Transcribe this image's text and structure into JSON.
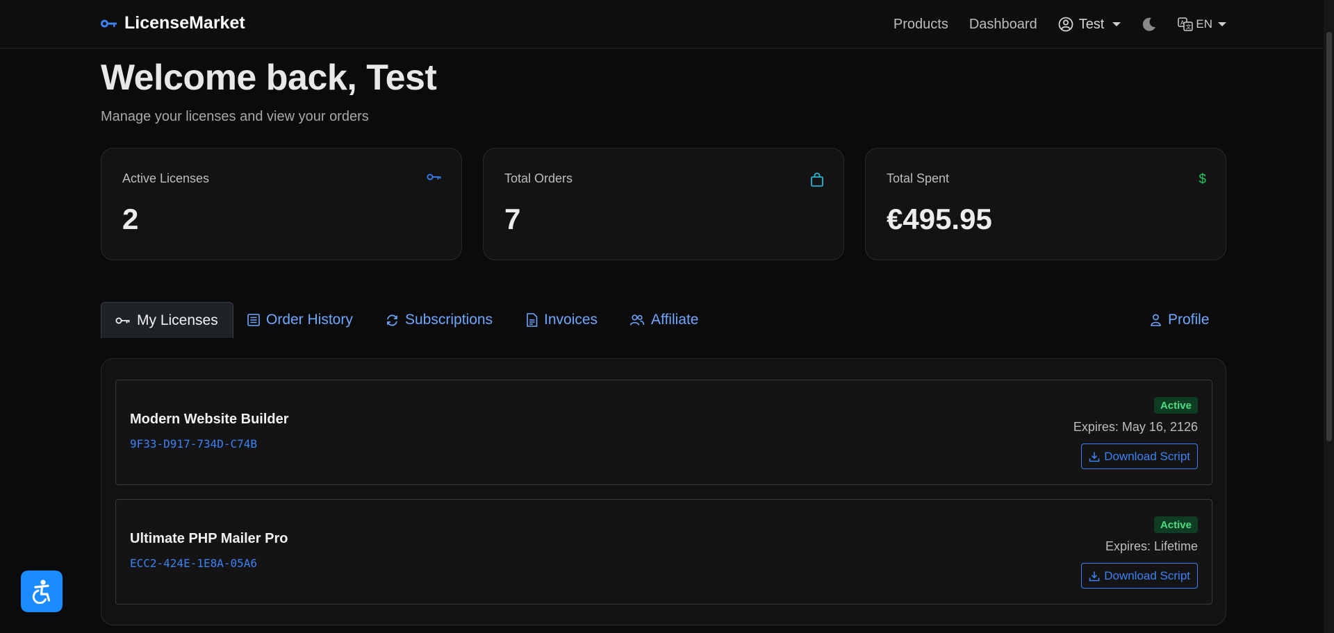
{
  "navbar": {
    "brand": "LicenseMarket",
    "products": "Products",
    "dashboard": "Dashboard",
    "user": "Test",
    "lang": "EN"
  },
  "header": {
    "title": "Welcome back, Test",
    "subtitle": "Manage your licenses and view your orders"
  },
  "stats": [
    {
      "label": "Active Licenses",
      "value": "2",
      "icon": "key-icon",
      "color": "#3b82f6"
    },
    {
      "label": "Total Orders",
      "value": "7",
      "icon": "bag-icon",
      "color": "#22b8cf"
    },
    {
      "label": "Total Spent",
      "value": "€495.95",
      "icon": "dollar-icon",
      "color": "#22c55e"
    }
  ],
  "tabs": {
    "my_licenses": "My Licenses",
    "order_history": "Order History",
    "subscriptions": "Subscriptions",
    "invoices": "Invoices",
    "affiliate": "Affiliate",
    "profile": "Profile"
  },
  "licenses": [
    {
      "name": "Modern Website Builder",
      "key": "9F33-D917-734D-C74B",
      "status": "Active",
      "expires": "Expires: May 16, 2126",
      "button": "Download Script"
    },
    {
      "name": "Ultimate PHP Mailer Pro",
      "key": "ECC2-424E-1E8A-05A6",
      "status": "Active",
      "expires": "Expires: Lifetime",
      "button": "Download Script"
    }
  ],
  "stat_symbol": "$"
}
